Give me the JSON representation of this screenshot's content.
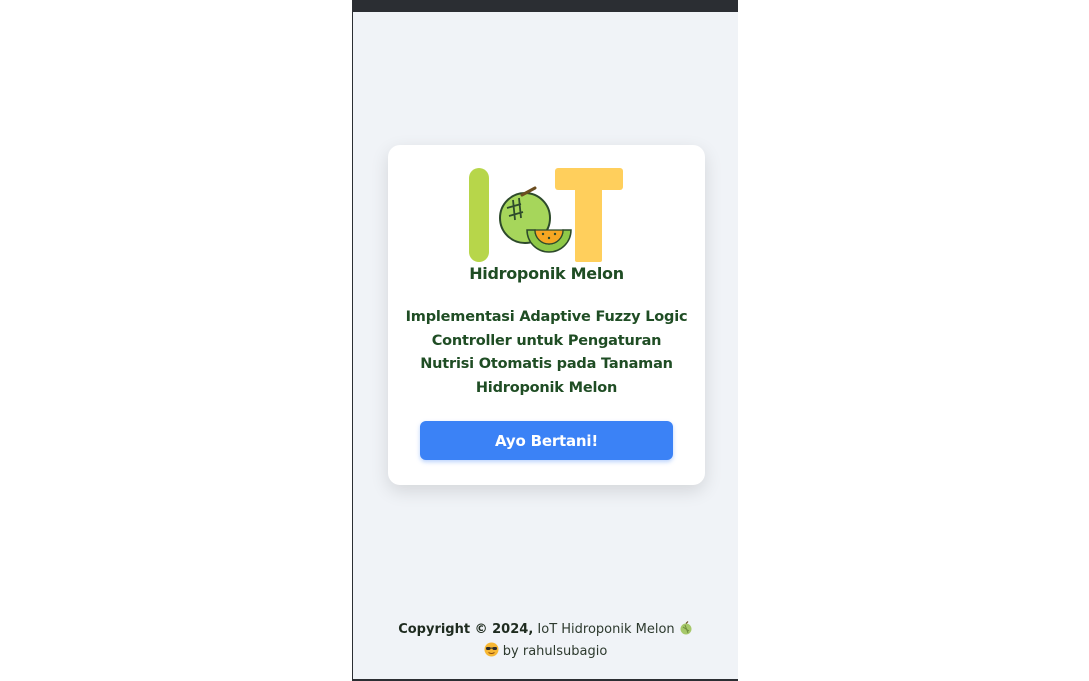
{
  "brand": {
    "logo_name": "Hidroponik Melon",
    "logo_letters": "IoT"
  },
  "card": {
    "tagline": "Implementasi Adaptive Fuzzy Logic Controller untuk Pengaturan Nutrisi Otomatis pada Tanaman Hidroponik Melon",
    "button_label": "Ayo Bertani!"
  },
  "footer": {
    "copyright_label": "Copyright © 2024,",
    "project_name": "IoT Hidroponik Melon",
    "author_text": "by rahulsubagio",
    "icons": [
      "melon-icon",
      "cool-face-icon"
    ]
  },
  "colors": {
    "background": "#f0f3f7",
    "card": "#ffffff",
    "primary_button": "#3b82f6",
    "brand_green_text": "#1f4d24",
    "logo_green": "#b7d64a",
    "logo_yellow": "#ffcf5c"
  }
}
